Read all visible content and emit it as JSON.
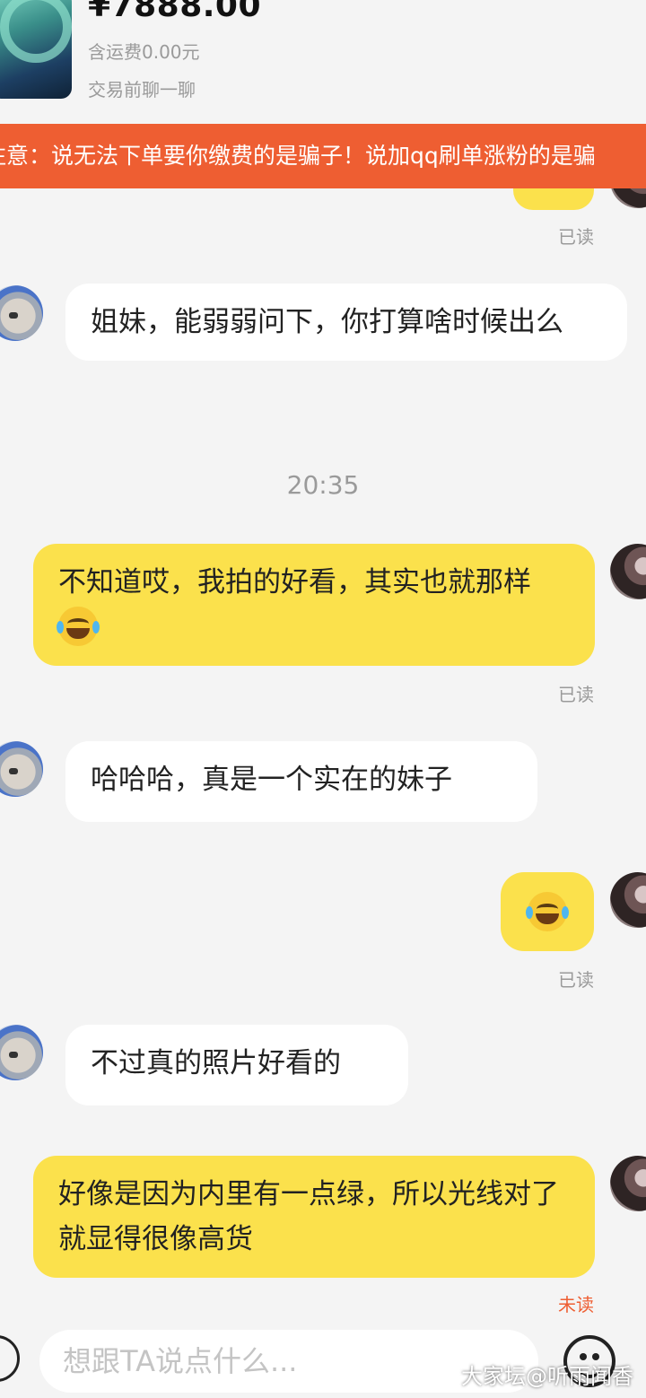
{
  "product": {
    "price": "¥7888.00",
    "shipping": "含运费0.00元",
    "chat_before_trade": "交易前聊一聊"
  },
  "warning_banner": "注意：说无法下单要你缴费的是骗子！说加qq刷单涨粉的是骗",
  "messages": [
    {
      "read": "已读"
    },
    {
      "from": "other",
      "text": "姐妹，能弱弱问下，你打算啥时候出么"
    },
    {
      "time": "20:35"
    },
    {
      "from": "self",
      "text": "不知道哎，我拍的好看，其实也就那样",
      "emoji": "laughing-tears",
      "read": "已读"
    },
    {
      "from": "other",
      "text": "哈哈哈，真是一个实在的妹子"
    },
    {
      "from": "self",
      "emoji": "laughing-tears",
      "read": "已读"
    },
    {
      "from": "other",
      "text": "不过真的照片好看的"
    },
    {
      "from": "self",
      "text": "好像是因为内里有一点绿，所以光线对了就显得很像高货",
      "read": "未读"
    }
  ],
  "input": {
    "placeholder": "想跟TA说点什么..."
  },
  "watermark": "大家坛@听雨闻香",
  "colors": {
    "banner": "#ee5e32",
    "outgoing_bubble": "#fbe14c",
    "incoming_bubble": "#ffffff",
    "unread": "#ee5e32"
  }
}
